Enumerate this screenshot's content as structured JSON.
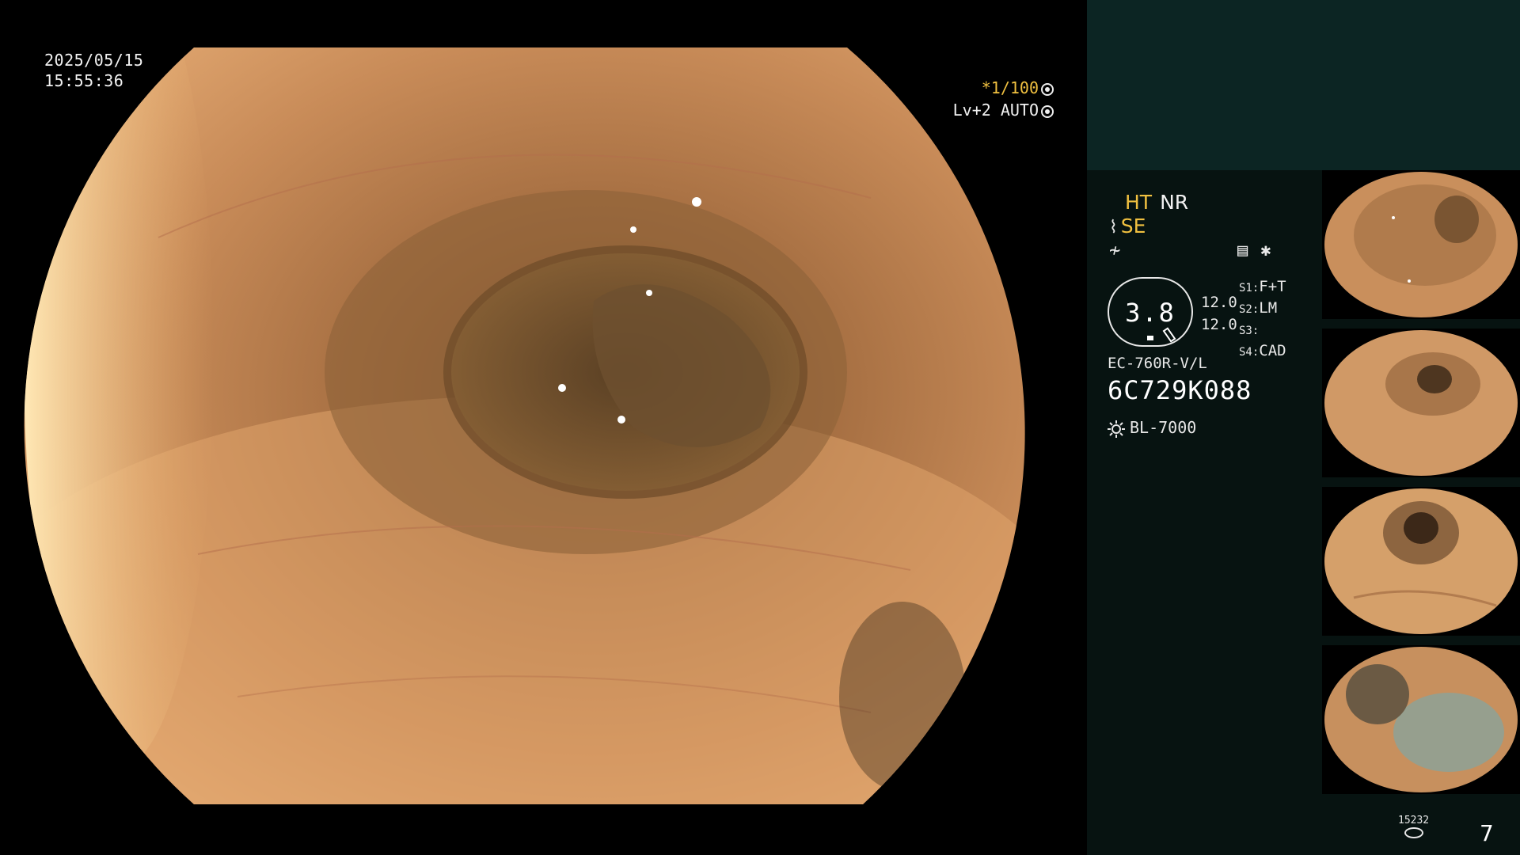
{
  "overlay": {
    "date": "2025/05/15",
    "time": "15:55:36",
    "shutter": "*1/100",
    "level": "Lv+2 AUTO"
  },
  "panel": {
    "mode_ht": "HT",
    "mode_nr": "NR",
    "mode_se": "SE",
    "gauge_value": "3.8",
    "level_a": "12.0",
    "level_b": "12.0",
    "s1_key": "S1:",
    "s1_val": "F+T",
    "s2_key": "S2:",
    "s2_val": "LM",
    "s3_key": "S3:",
    "s3_val": "",
    "s4_key": "S4:",
    "s4_val": "CAD",
    "scope_model": "EC-760R-V/L",
    "serial": "6C729K088",
    "light_source": "BL-7000",
    "record_label": "15232",
    "image_count": "7"
  },
  "colors": {
    "accent": "#f0c040",
    "panel_bg": "#071311",
    "panel_header": "#0c2523"
  },
  "icons": [
    "shutter-icon",
    "iris-icon",
    "structure-icon",
    "color-icon",
    "settings-icon",
    "asterisk-icon",
    "light-icon",
    "disk-icon"
  ]
}
